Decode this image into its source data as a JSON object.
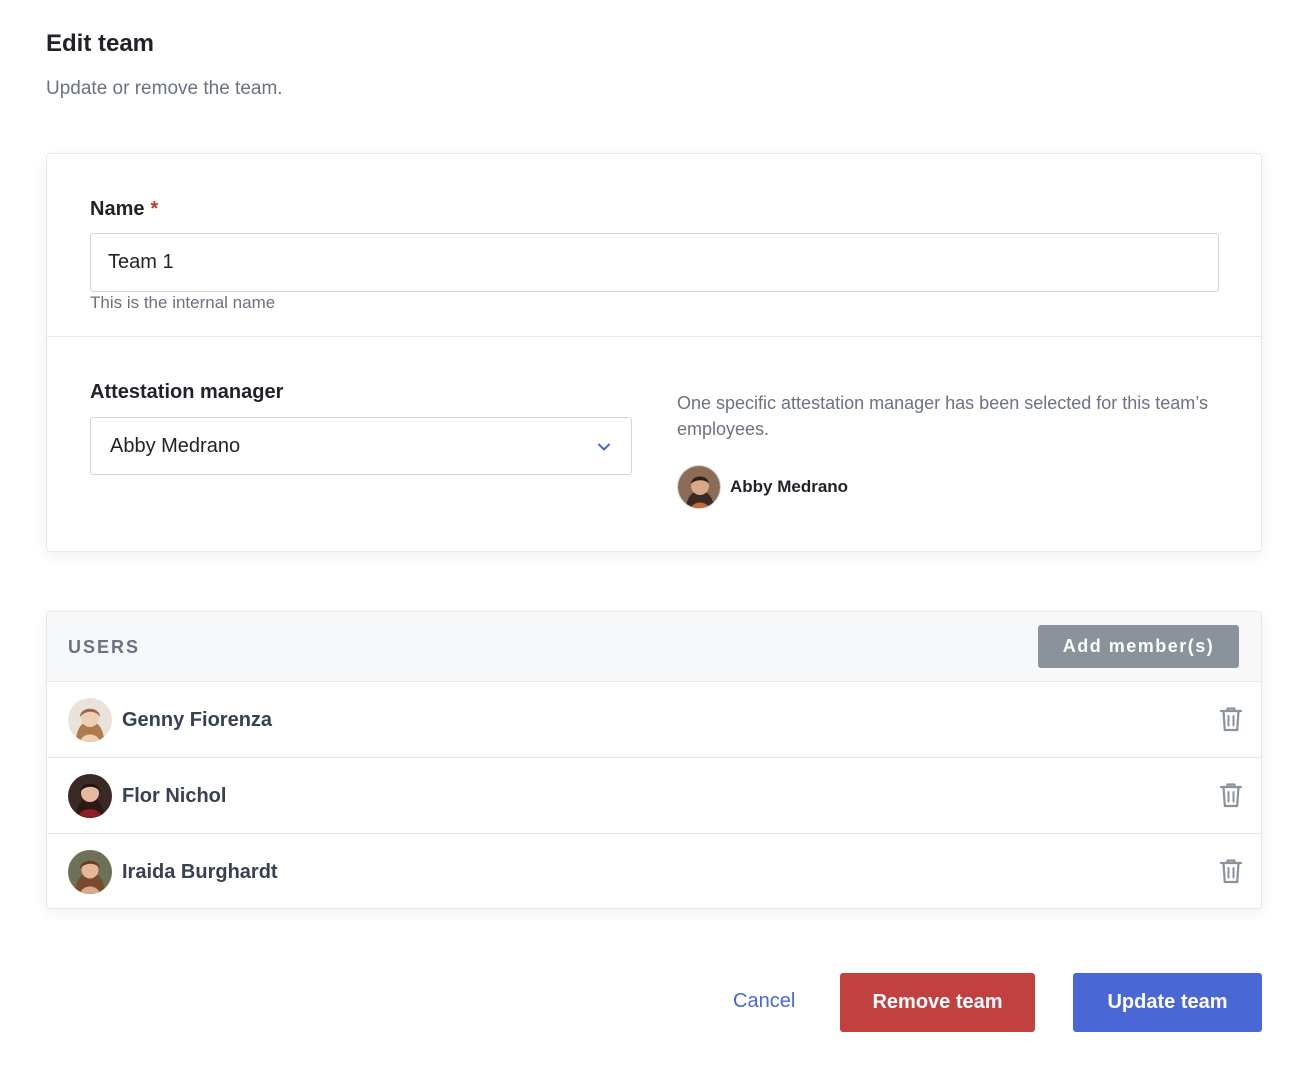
{
  "header": {
    "title": "Edit team",
    "subtitle": "Update or remove the team."
  },
  "form": {
    "name_label": "Name",
    "required_mark": "*",
    "name_value": "Team 1",
    "name_help": "This is the internal name",
    "manager_label": "Attestation manager",
    "manager_selected": "Abby Medrano",
    "manager_note": "One specific attestation manager has been selected for this team’s employees.",
    "manager_person_name": "Abby Medrano"
  },
  "users": {
    "title": "USERS",
    "add_label": "Add member(s)",
    "items": [
      {
        "name": "Genny Fiorenza"
      },
      {
        "name": "Flor Nichol"
      },
      {
        "name": "Iraida Burghardt"
      }
    ]
  },
  "actions": {
    "cancel": "Cancel",
    "remove": "Remove team",
    "update": "Update team"
  },
  "colors": {
    "primary": "#4a67d6",
    "danger": "#c0413f",
    "muted_button": "#8a939c",
    "required": "#c0392b"
  },
  "icons": {
    "chevron": "chevron-down-icon",
    "delete": "trash-icon"
  }
}
